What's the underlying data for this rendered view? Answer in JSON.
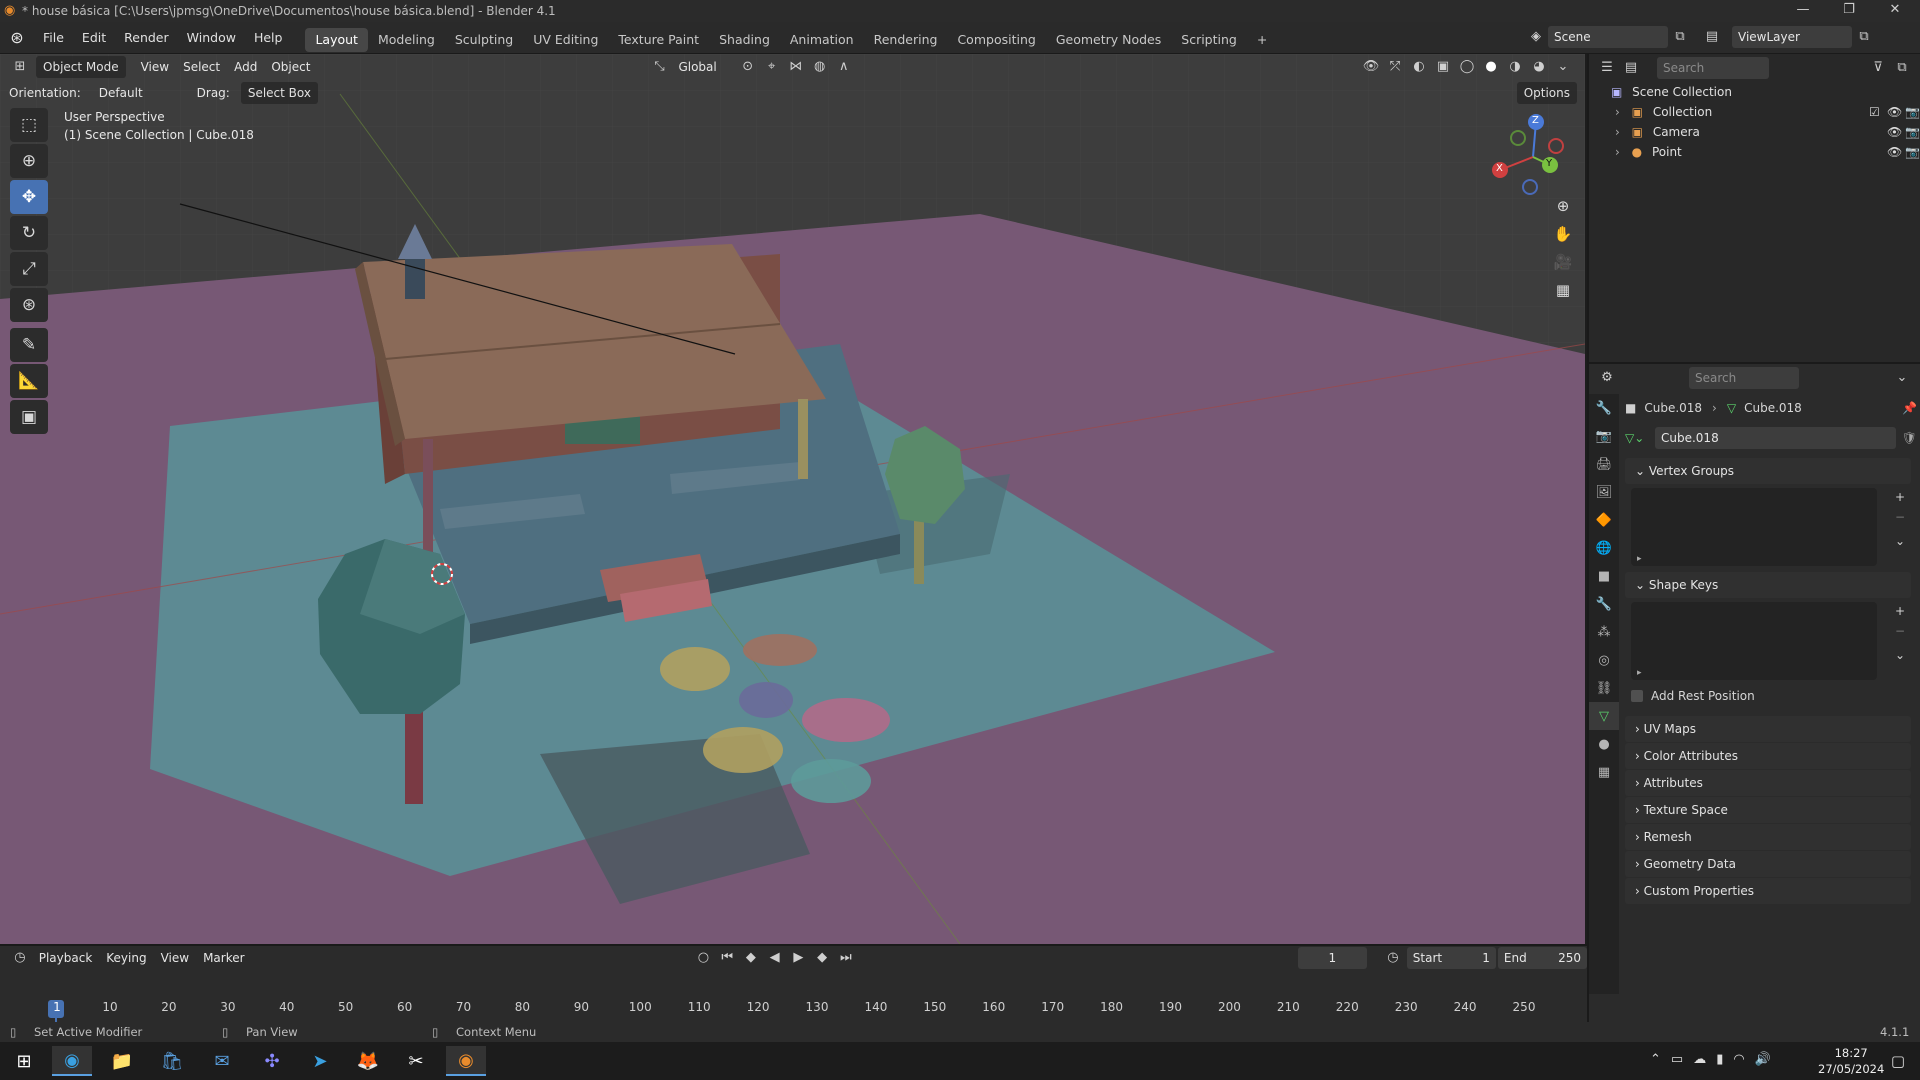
{
  "window": {
    "title": "* house básica [C:\\Users\\jpmsg\\OneDrive\\Documentos\\house básica.blend] - Blender 4.1",
    "minimize": "—",
    "maximize": "❐",
    "close": "✕"
  },
  "menu": [
    "File",
    "Edit",
    "Render",
    "Window",
    "Help"
  ],
  "workspaces": [
    "Layout",
    "Modeling",
    "Sculpting",
    "UV Editing",
    "Texture Paint",
    "Shading",
    "Animation",
    "Rendering",
    "Compositing",
    "Geometry Nodes",
    "Scripting"
  ],
  "workspace_add": "+",
  "scene": {
    "name": "Scene",
    "view_layer": "ViewLayer"
  },
  "viewport": {
    "mode": "Object Mode",
    "menus": [
      "View",
      "Select",
      "Add",
      "Object"
    ],
    "transform_orientation": "Global",
    "orientation_label": "Orientation:",
    "orientation_value": "Default",
    "drag_label": "Drag:",
    "drag_value": "Select Box",
    "options_label": "Options",
    "view_name": "User Perspective",
    "view_context": "(1) Scene Collection | Cube.018",
    "gizmo_axes": {
      "x": "X",
      "y": "Y",
      "z": "Z"
    }
  },
  "tools": [
    "select-box",
    "cursor",
    "move",
    "rotate",
    "scale",
    "transform",
    "annotate",
    "measure",
    "add-cube"
  ],
  "outliner": {
    "search_placeholder": "Search",
    "root": "Scene Collection",
    "items": [
      {
        "name": "Collection",
        "type": "collection"
      },
      {
        "name": "Camera",
        "type": "camera"
      },
      {
        "name": "Point",
        "type": "light"
      }
    ]
  },
  "properties": {
    "search_placeholder": "Search",
    "breadcrumb_object": "Cube.018",
    "breadcrumb_data": "Cube.018",
    "mesh_name": "Cube.018",
    "panels": {
      "vertex_groups": "Vertex Groups",
      "shape_keys": "Shape Keys",
      "add_rest_position": "Add Rest Position",
      "collapsed": [
        "UV Maps",
        "Color Attributes",
        "Attributes",
        "Texture Space",
        "Remesh",
        "Geometry Data",
        "Custom Properties"
      ]
    }
  },
  "timeline": {
    "menus": [
      "Playback",
      "Keying",
      "View",
      "Marker"
    ],
    "current_frame": "1",
    "start_label": "Start",
    "start": "1",
    "end_label": "End",
    "end": "250",
    "ruler": [
      "1",
      "10",
      "20",
      "30",
      "40",
      "50",
      "60",
      "70",
      "80",
      "90",
      "100",
      "110",
      "120",
      "130",
      "140",
      "150",
      "160",
      "170",
      "180",
      "190",
      "200",
      "210",
      "220",
      "230",
      "240",
      "250"
    ]
  },
  "statusbar": {
    "left": "Set Active Modifier",
    "middle": "Pan View",
    "right": "Context Menu",
    "version": "4.1.1"
  },
  "taskbar": {
    "time": "18:27",
    "date": "27/05/2024"
  },
  "colors": {
    "accent": "#4772b3",
    "ground": "#7a5a78",
    "plane": "#5d8a93",
    "roof": "#8a6a58"
  }
}
